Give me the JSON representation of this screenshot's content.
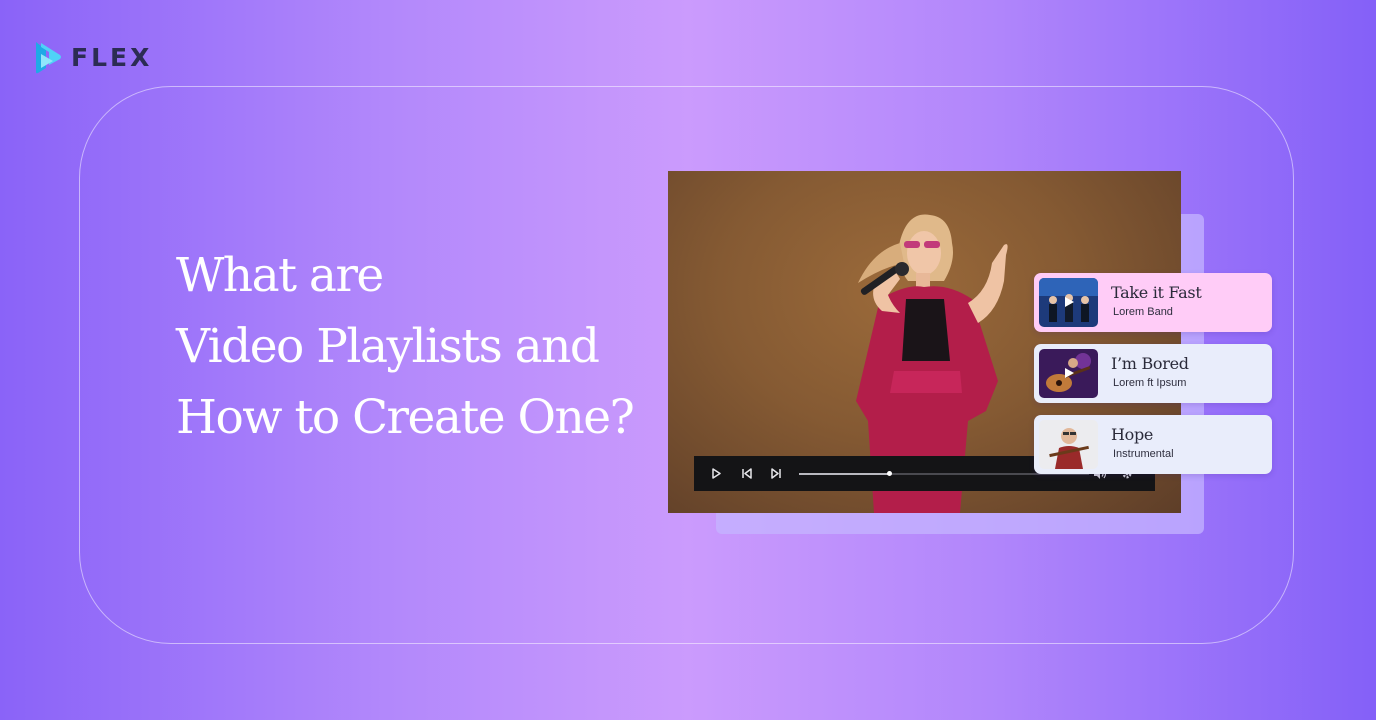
{
  "brand": {
    "name": "FLEX",
    "logo_color": "#2ec4f0"
  },
  "headline": {
    "lines": [
      "What are",
      "Video Playlists and",
      "How to Create One?"
    ]
  },
  "player": {
    "progress": 0.31,
    "controls": [
      "play-icon",
      "previous-icon",
      "next-icon",
      "volume-icon",
      "settings-icon"
    ]
  },
  "playlist": [
    {
      "title": "Take it Fast",
      "artist": "Lorem Band",
      "background": "#ffccf7"
    },
    {
      "title": "I’m Bored",
      "artist": "Lorem ft Ipsum",
      "background": "#e9edfb"
    },
    {
      "title": "Hope",
      "artist": "Instrumental",
      "background": "#e9edfb"
    }
  ]
}
